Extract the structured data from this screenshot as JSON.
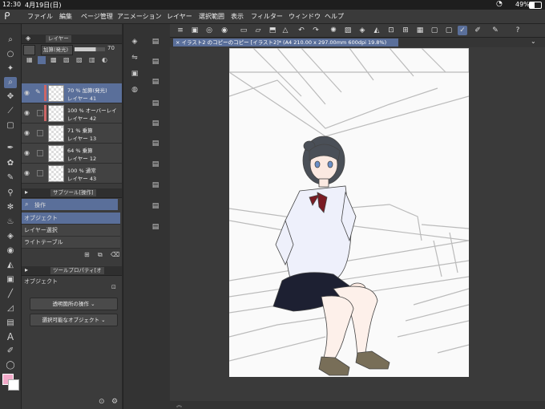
{
  "status": {
    "time": "12:30",
    "date": "4月19日(日)",
    "battery": "49%"
  },
  "menu": [
    "ファイル",
    "編集",
    "ページ管理",
    "アニメーション",
    "レイヤー",
    "選択範囲",
    "表示",
    "フィルター",
    "ウィンドウ",
    "ヘルプ"
  ],
  "layer_panel": {
    "tab_label": "レイヤー",
    "blend_mode": "加算(発光)",
    "opacity": "70",
    "layers": [
      {
        "line1": "70 % 加算(発光)",
        "line2": "レイヤー 41"
      },
      {
        "line1": "100 % オーバーレイ",
        "line2": "レイヤー 42"
      },
      {
        "line1": "71 % 乗算",
        "line2": "レイヤー 13"
      },
      {
        "line1": "64 % 乗算",
        "line2": "レイヤー 12"
      },
      {
        "line1": "100 % 通常",
        "line2": "レイヤー 43"
      }
    ]
  },
  "subtool_panel": {
    "tab_label": "サブツール[操作]",
    "group_label": "操作",
    "items": [
      "オブジェクト",
      "レイヤー選択",
      "ライトテーブル"
    ]
  },
  "tool_property": {
    "tab_label": "ツールプロパティ[オ",
    "title": "オブジェクト",
    "dropdown1": "透明箇所の操作",
    "dropdown2": "選択可能なオブジェクト"
  },
  "document": {
    "tab_title": "イラスト2 のコピーのコピー [イラスト2]* (A4 210.00 x 297.00mm 600dpi 19.8%)"
  },
  "colors": {
    "accent": "#5a6f9a",
    "main_color": "#f2a9c8",
    "sub_color": "#ffffff"
  },
  "icons": [
    "clip-icon",
    "search-icon",
    "zoom-icon",
    "move-icon",
    "pen-icon",
    "eraser-icon",
    "undo-icon",
    "redo-icon"
  ]
}
